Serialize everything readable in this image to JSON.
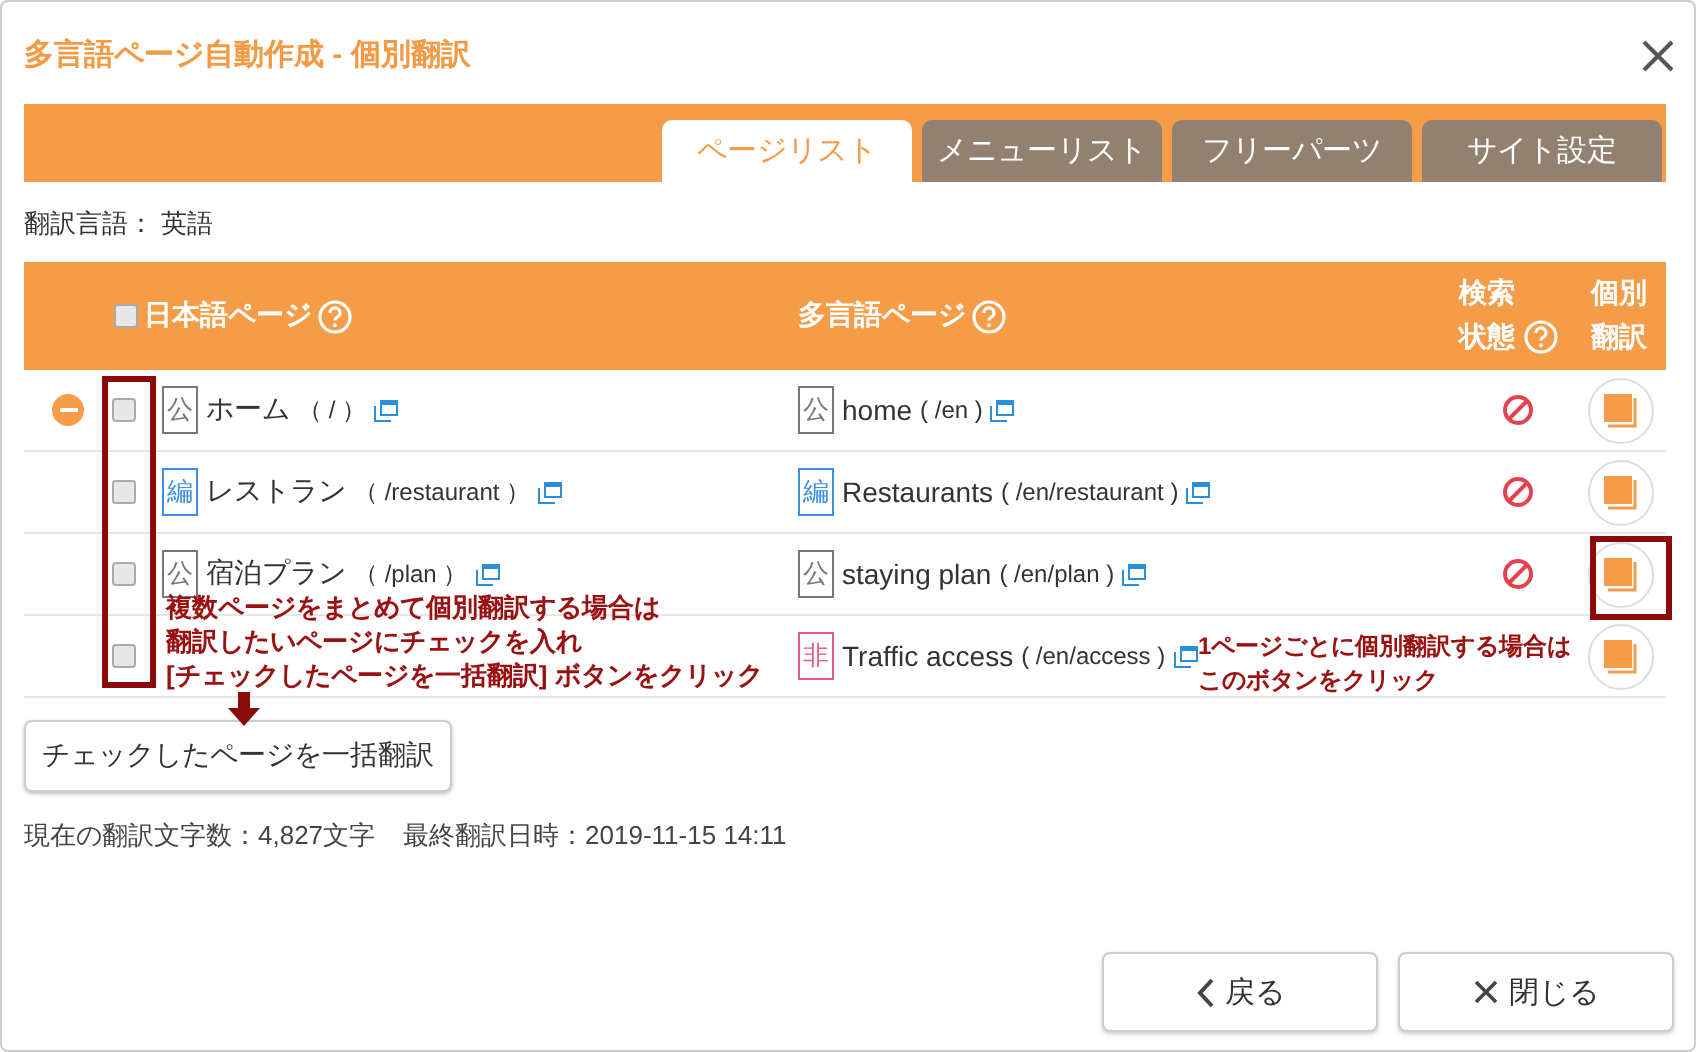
{
  "dialog": {
    "title": "多言語ページ自動作成 - 個別翻訳"
  },
  "tabs": [
    {
      "label": "ページリスト",
      "selected": true
    },
    {
      "label": "メニューリスト",
      "selected": false
    },
    {
      "label": "フリーパーツ",
      "selected": false
    },
    {
      "label": "サイト設定",
      "selected": false
    }
  ],
  "language_label": "翻訳言語： 英語",
  "table": {
    "select_all": {
      "checked": false
    },
    "columns": [
      {
        "label": "日本語ページ"
      },
      {
        "label": "多言語ページ"
      },
      {
        "label": "検索状態"
      },
      {
        "label": "個別翻訳"
      }
    ],
    "rows": [
      {
        "expanded": true,
        "checked": false,
        "jp": {
          "badge": {
            "kind": "public",
            "label": "公"
          },
          "title": "ホーム",
          "path": "（ / ）"
        },
        "ml": {
          "badge": {
            "kind": "public",
            "label": "公"
          },
          "title": "home",
          "path": "( /en )"
        },
        "search_status": {
          "kind": "blocked"
        }
      },
      {
        "expanded": false,
        "checked": false,
        "jp": {
          "badge": {
            "kind": "edit",
            "label": "編"
          },
          "title": "レストラン",
          "path": "（ /restaurant ）"
        },
        "ml": {
          "badge": {
            "kind": "edit",
            "label": "編"
          },
          "title": "Restaurants",
          "path": "( /en/restaurant )"
        },
        "search_status": {
          "kind": "blocked"
        }
      },
      {
        "expanded": false,
        "checked": false,
        "jp": {
          "badge": {
            "kind": "public",
            "label": "公"
          },
          "title": "宿泊プラン",
          "path": "（ /plan ）"
        },
        "ml": {
          "badge": {
            "kind": "public",
            "label": "公"
          },
          "title": "staying plan",
          "path": "( /en/plan )"
        },
        "search_status": {
          "kind": "blocked"
        }
      },
      {
        "expanded": false,
        "checked": false,
        "ml": {
          "badge": {
            "kind": "private",
            "label": "非"
          },
          "title": "Traffic access",
          "path": "( /en/access )"
        }
      }
    ]
  },
  "bulk_button": "チェックしたページを一括翻訳",
  "stats": [
    "現在の翻訳文字数：4,827文字",
    "最終翻訳日時：2019-11-15 14:11"
  ],
  "footer_buttons": [
    {
      "kind": "back",
      "label": "戻る"
    },
    {
      "kind": "close",
      "label": "閉じる"
    }
  ],
  "annotations": [
    {
      "kind": "bulk",
      "lines": [
        "複数ページをまとめて個別翻訳する場合は",
        "翻訳したいページにチェックを入れ",
        "[チェックしたページを一括翻訳] ボタンをクリック"
      ]
    },
    {
      "kind": "single",
      "lines": [
        "1ページごとに個別翻訳する場合は",
        "このボタンをクリック"
      ]
    }
  ]
}
